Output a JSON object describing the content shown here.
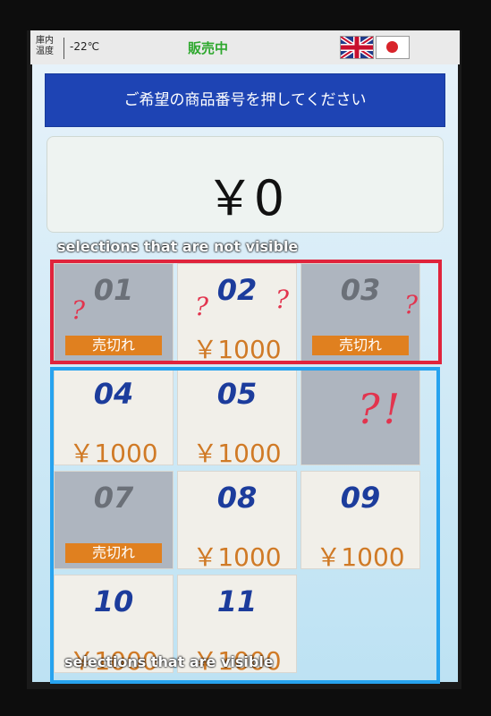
{
  "status_bar": {
    "temp_label": "庫内\n温度",
    "temp_value": "-22℃",
    "sale_status": "販売中",
    "flags": [
      "uk-flag-icon",
      "japan-flag-icon"
    ]
  },
  "screen": {
    "banner_text": "ご希望の商品番号を押してください",
    "price_display": "￥0"
  },
  "products": [
    {
      "number": "01",
      "price": "",
      "soldout": true,
      "soldout_label": "売切れ"
    },
    {
      "number": "02",
      "price": "￥1000",
      "soldout": false,
      "soldout_label": ""
    },
    {
      "number": "03",
      "price": "",
      "soldout": true,
      "soldout_label": "売切れ"
    },
    {
      "number": "04",
      "price": "￥1000",
      "soldout": false,
      "soldout_label": ""
    },
    {
      "number": "05",
      "price": "￥1000",
      "soldout": false,
      "soldout_label": ""
    },
    {
      "number": "",
      "price": "",
      "soldout": false,
      "soldout_label": ""
    },
    {
      "number": "07",
      "price": "",
      "soldout": true,
      "soldout_label": "売切れ"
    },
    {
      "number": "08",
      "price": "￥1000",
      "soldout": false,
      "soldout_label": ""
    },
    {
      "number": "09",
      "price": "￥1000",
      "soldout": false,
      "soldout_label": ""
    },
    {
      "number": "10",
      "price": "￥1000",
      "soldout": false,
      "soldout_label": ""
    },
    {
      "number": "11",
      "price": "￥1000",
      "soldout": false,
      "soldout_label": ""
    }
  ],
  "annotations": {
    "top_label": "selections that are not visible",
    "bottom_label": "selections that are visible",
    "question_marks": [
      "?",
      "?",
      "?",
      "?",
      "?",
      "?!"
    ],
    "red_color": "#e0243c",
    "blue_color": "#27a3ef"
  }
}
